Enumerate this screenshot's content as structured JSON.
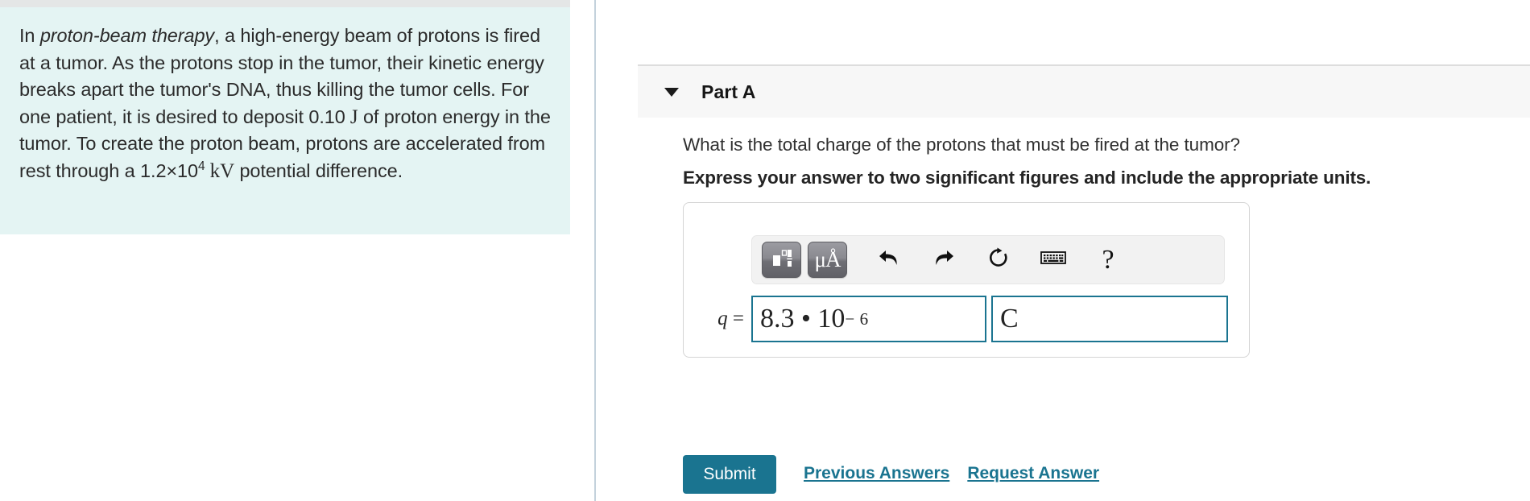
{
  "colors": {
    "problem_panel_bg": "#e4f4f3",
    "accent_teal": "#1a7490",
    "header_bg": "#f7f7f7",
    "divider": "#c3d2dc",
    "toolbar_bg": "#f2f2f2"
  },
  "problem": {
    "text_part1": "In ",
    "emphasis": "proton-beam therapy",
    "text_part2": ", a high-energy beam of protons is fired at a tumor. As the protons stop in the tumor, their kinetic energy breaks apart the tumor's DNA, thus killing the tumor cells. For one patient, it is desired to deposit ",
    "energy_value": "0.10",
    "energy_unit": "J",
    "text_part3": " of proton energy in the tumor. To create the proton beam, protons are accelerated from rest through a ",
    "voltage_mantissa": "1.2×10",
    "voltage_exponent": "4",
    "voltage_unit": "kV",
    "text_part4": " potential difference."
  },
  "part": {
    "caret_icon": "chevron-down-icon",
    "title": "Part A",
    "question": "What is the total charge of the protons that must be fired at the tumor?",
    "instruction": "Express your answer to two significant figures and include the appropriate units."
  },
  "toolbar": {
    "buttons": [
      {
        "name": "math-template-icon",
        "label": ""
      },
      {
        "name": "units-mu-angstrom-icon",
        "label": "μÅ"
      },
      {
        "name": "undo-icon",
        "label": ""
      },
      {
        "name": "redo-icon",
        "label": ""
      },
      {
        "name": "reset-icon",
        "label": ""
      },
      {
        "name": "keyboard-icon",
        "label": ""
      },
      {
        "name": "help-icon",
        "label": "?"
      }
    ]
  },
  "answer": {
    "variable_label": "q",
    "equals": "=",
    "value_mantissa": "8.3 • 10",
    "value_exponent": "− 6",
    "unit_value": "C",
    "value_placeholder": "",
    "unit_placeholder": ""
  },
  "actions": {
    "submit_label": "Submit",
    "previous_answers_label": "Previous Answers",
    "request_answer_label": "Request Answer"
  }
}
